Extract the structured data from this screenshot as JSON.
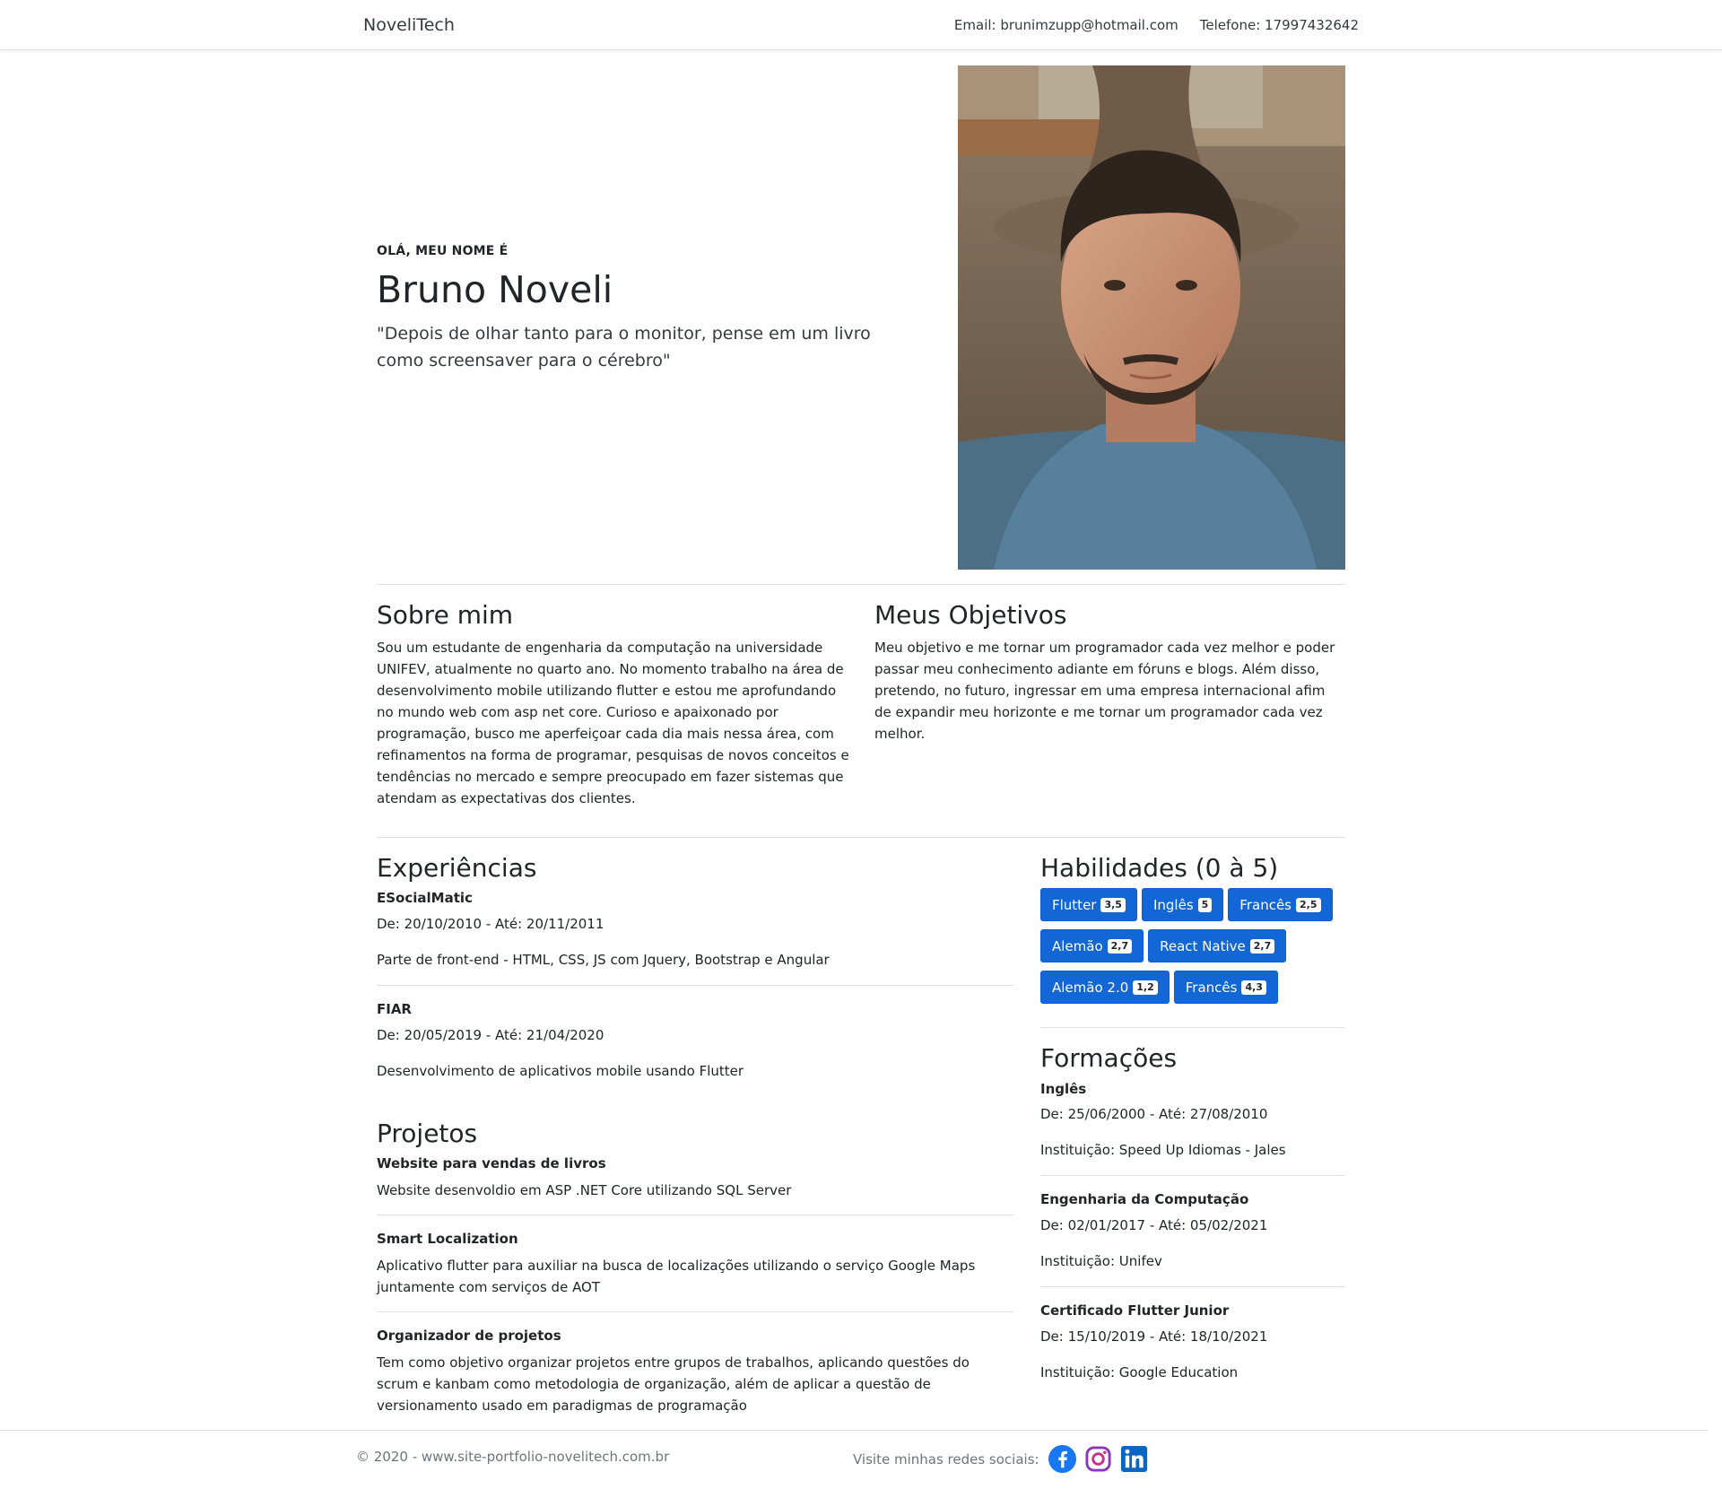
{
  "navbar": {
    "brand": "NoveliTech",
    "email": "Email: brunimzupp@hotmail.com",
    "phone": "Telefone: 17997432642"
  },
  "hero": {
    "eyebrow": "OLÁ, MEU NOME É",
    "name": "Bruno Noveli",
    "quote": "\"Depois de olhar tanto para o monitor, pense em um livro como screensaver para o cérebro\""
  },
  "about": {
    "title": "Sobre mim",
    "text": "Sou um estudante de engenharia da computação na universidade UNIFEV, atualmente no quarto ano. No momento trabalho na área de desenvolvimento mobile utilizando flutter e estou me aprofundando no mundo web com asp net core. Curioso e apaixonado por programação, busco me aperfeiçoar cada dia mais nessa área, com refinamentos na forma de programar, pesquisas de novos conceitos e tendências no mercado e sempre preocupado em fazer sistemas que atendam as expectativas dos clientes."
  },
  "goals": {
    "title": "Meus Objetivos",
    "text": "Meu objetivo e me tornar um programador cada vez melhor e poder passar meu conhecimento adiante em fóruns e blogs. Além disso, pretendo, no futuro, ingressar em uma empresa internacional afim de expandir meu horizonte e me tornar um programador cada vez melhor."
  },
  "experiences": {
    "title": "Experiências",
    "items": [
      {
        "company": "ESocialMatic",
        "period": "De: 20/10/2010 - Até: 20/11/2011",
        "description": "Parte de front-end - HTML, CSS, JS com Jquery, Bootstrap e Angular"
      },
      {
        "company": "FIAR",
        "period": "De: 20/05/2019 - Até: 21/04/2020",
        "description": "Desenvolvimento de aplicativos mobile usando Flutter"
      }
    ]
  },
  "projects": {
    "title": "Projetos",
    "items": [
      {
        "name": "Website para vendas de livros",
        "description": "Website desenvoldio em ASP .NET Core utilizando SQL Server"
      },
      {
        "name": "Smart Localization",
        "description": "Aplicativo flutter para auxiliar na busca de localizações utilizando o serviço Google Maps juntamente com serviços de AOT"
      },
      {
        "name": "Organizador de projetos",
        "description": "Tem como objetivo organizar projetos entre grupos de trabalhos, aplicando questões do scrum e kanbam como metodologia de organização, além de aplicar a questão de versionamento usado em paradigmas de programação"
      }
    ]
  },
  "skills": {
    "title": "Habilidades (0 à 5)",
    "color": "#1366d6",
    "rows": [
      [
        {
          "label": "Flutter",
          "score": "3,5"
        },
        {
          "label": "Inglês",
          "score": "5"
        },
        {
          "label": "Francês",
          "score": "2,5"
        }
      ],
      [
        {
          "label": "Alemão",
          "score": "2,7"
        },
        {
          "label": "React Native",
          "score": "2,7"
        }
      ],
      [
        {
          "label": "Alemão 2.0",
          "score": "1,2"
        },
        {
          "label": "Francês",
          "score": "4,3"
        }
      ]
    ]
  },
  "education": {
    "title": "Formações",
    "items": [
      {
        "course": "Inglês",
        "period": "De: 25/06/2000 - Até: 27/08/2010",
        "institution": "Instituição: Speed Up Idiomas - Jales"
      },
      {
        "course": "Engenharia da Computação",
        "period": "De: 02/01/2017 - Até: 05/02/2021",
        "institution": "Instituição: Unifev"
      },
      {
        "course": "Certificado Flutter Junior",
        "period": "De: 15/10/2019 - Até: 18/10/2021",
        "institution": "Instituição: Google Education"
      }
    ]
  },
  "footer": {
    "copyright": "© 2020 - www.site-portfolio-novelitech.com.br",
    "social_label": "Visite minhas redes sociais:",
    "icons": [
      "facebook-icon",
      "instagram-icon",
      "linkedin-icon"
    ]
  }
}
